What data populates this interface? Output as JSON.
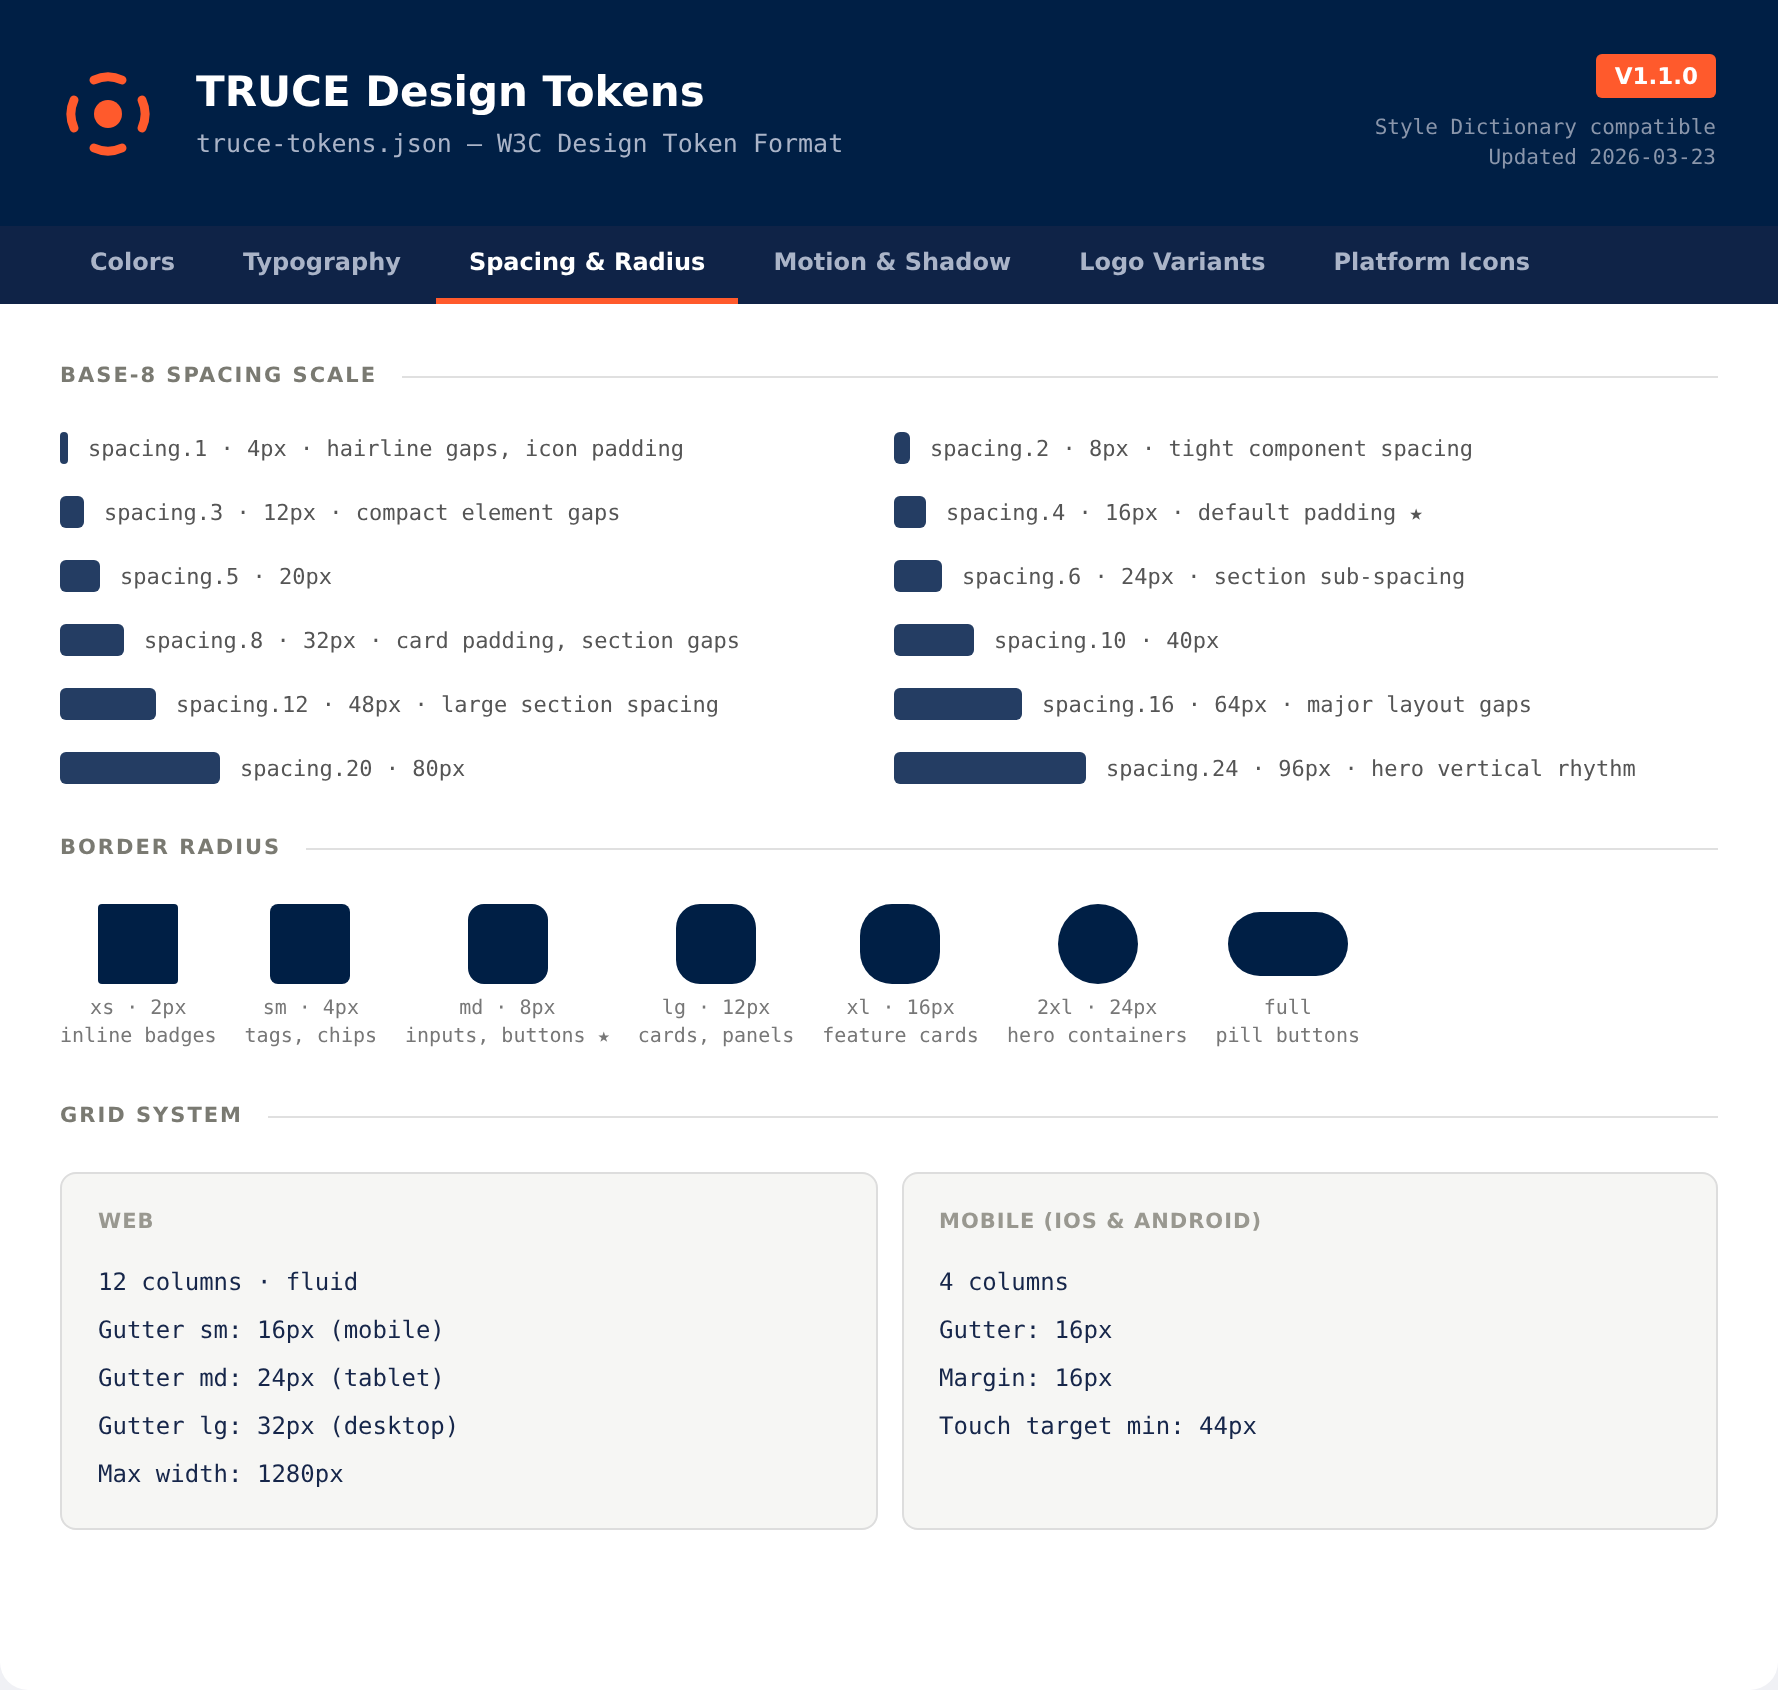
{
  "header": {
    "title": "TRUCE Design Tokens",
    "subtitle": "truce-tokens.json — W3C Design Token Format",
    "version": "V1.1.0",
    "compat": "Style Dictionary compatible",
    "updated": "Updated 2026-03-23"
  },
  "tabs": [
    {
      "label": "Colors",
      "selected": false
    },
    {
      "label": "Typography",
      "selected": false
    },
    {
      "label": "Spacing & Radius",
      "selected": true
    },
    {
      "label": "Motion & Shadow",
      "selected": false
    },
    {
      "label": "Logo Variants",
      "selected": false
    },
    {
      "label": "Platform Icons",
      "selected": false
    }
  ],
  "spacing": {
    "heading": "BASE-8 SPACING SCALE",
    "items": [
      {
        "label": "spacing.1 · 4px · hairline gaps, icon padding"
      },
      {
        "label": "spacing.2 · 8px · tight component spacing"
      },
      {
        "label": "spacing.3 · 12px · compact element gaps"
      },
      {
        "label": "spacing.4 · 16px · default padding ★"
      },
      {
        "label": "spacing.5 · 20px"
      },
      {
        "label": "spacing.6 · 24px · section sub-spacing"
      },
      {
        "label": "spacing.8 · 32px · card padding, section gaps"
      },
      {
        "label": "spacing.10 · 40px"
      },
      {
        "label": "spacing.12 · 48px · large section spacing"
      },
      {
        "label": "spacing.16 · 64px · major layout gaps"
      },
      {
        "label": "spacing.20 · 80px"
      },
      {
        "label": "spacing.24 · 96px · hero vertical rhythm"
      }
    ]
  },
  "radius": {
    "heading": "BORDER RADIUS",
    "items": [
      {
        "kind": "fixed",
        "name": "xs · 2px",
        "use": "inline badges"
      },
      {
        "kind": "fixed",
        "name": "sm · 4px",
        "use": "tags, chips"
      },
      {
        "kind": "fixed",
        "name": "md · 8px",
        "use": "inputs, buttons ★"
      },
      {
        "kind": "fixed",
        "name": "lg · 12px",
        "use": "cards, panels"
      },
      {
        "kind": "fixed",
        "name": "xl · 16px",
        "use": "feature cards"
      },
      {
        "kind": "fixed",
        "name": "2xl · 24px",
        "use": "hero containers"
      },
      {
        "kind": "pill",
        "name": "full",
        "use": "pill buttons"
      }
    ]
  },
  "grid": {
    "heading": "GRID SYSTEM",
    "cards": [
      {
        "title": "WEB",
        "lines": [
          "12 columns · fluid",
          "Gutter sm: 16px (mobile)",
          "Gutter md: 24px (tablet)",
          "Gutter lg: 32px (desktop)",
          "Max width: 1280px"
        ]
      },
      {
        "title": "MOBILE (IOS & ANDROID)",
        "lines": [
          "4 columns",
          "Gutter: 16px",
          "Margin: 16px",
          "Touch target min: 44px"
        ]
      }
    ]
  }
}
